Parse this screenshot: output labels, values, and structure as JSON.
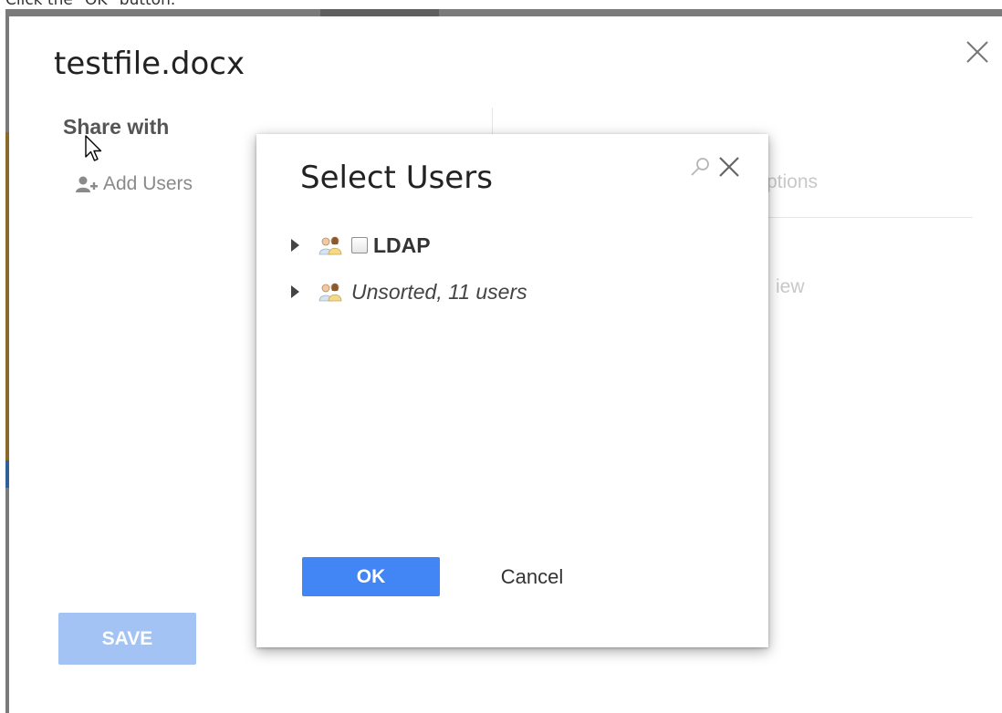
{
  "instruction": "Click the \"OK\" button.",
  "share_dialog": {
    "title": "testfile.docx",
    "share_with_label": "Share with",
    "add_users_label": "Add Users",
    "options_tab_partial": "ptions",
    "view_partial": "iew",
    "save_label": "SAVE"
  },
  "select_users_modal": {
    "title": "Select Users",
    "tree": [
      {
        "label": "LDAP",
        "has_checkbox": true,
        "checked": false
      },
      {
        "label": "Unsorted, 11 users",
        "has_checkbox": false
      }
    ],
    "ok_label": "OK",
    "cancel_label": "Cancel"
  },
  "colors": {
    "primary": "#4285f4",
    "primary_disabled": "#a3c3f5",
    "text": "#222222",
    "muted": "#8a8a8a"
  },
  "icons": {
    "outer_close": "close-icon",
    "add_users": "add-user-icon",
    "modal_search": "search-icon",
    "modal_close": "close-icon",
    "tree_expand": "caret-right-icon",
    "group": "user-group-icon"
  }
}
